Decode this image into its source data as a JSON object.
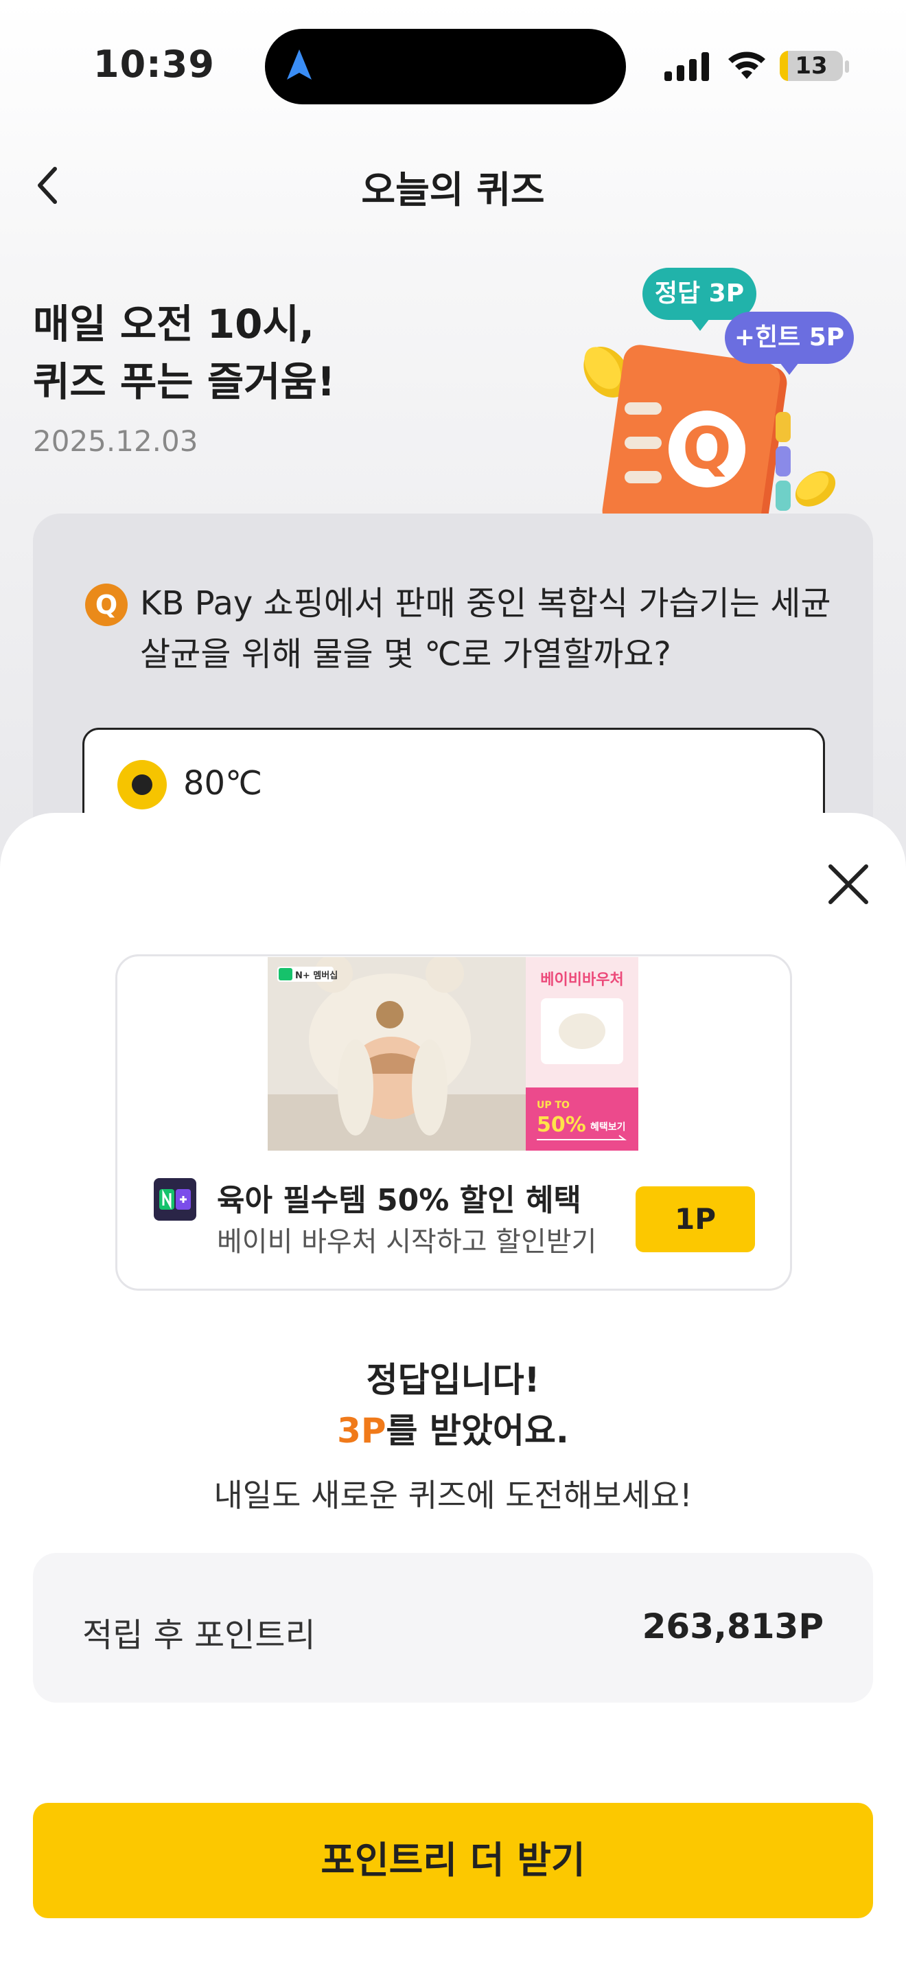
{
  "status_bar": {
    "time": "10:39",
    "battery": "13",
    "battery_level": 0.13
  },
  "header": {
    "title": "오늘의 퀴즈"
  },
  "hero": {
    "headline_line1": "매일 오전 10시,",
    "headline_line2": "퀴즈 푸는 즐거움!",
    "date": "2025.12.03",
    "badge_correct": "정답 3P",
    "badge_hint": "+힌트 5P",
    "illustration_letter": "Q"
  },
  "quiz": {
    "q_icon": "Q",
    "question_line1": "KB Pay 쇼핑에서 판매 중인 복합식 가습기는 세균",
    "question_line2": "살균을 위해 물을 몇 ℃로 가열할까요?",
    "selected_option": "80℃"
  },
  "ad": {
    "title": "육아 필수템 50% 할인 혜택",
    "subtitle": "베이비 바우처 시작하고 할인받기",
    "point_button": "1P",
    "image_brand": "N+ 멤버십",
    "image_heading": "베이비바우처",
    "image_upto": "UP TO",
    "image_percent": "50%",
    "image_suffix": "혜택보기"
  },
  "result": {
    "title": "정답입니다!",
    "points_accent": "3P",
    "points_suffix": "를 받았어요.",
    "desc": "내일도 새로운 퀴즈에 도전해보세요!"
  },
  "balance": {
    "label": "적립 후 포인트리",
    "value": "263,813P"
  },
  "cta": {
    "label": "포인트리 더 받기"
  },
  "colors": {
    "accent_yellow": "#fcc800",
    "badge_teal": "#21b3aa",
    "badge_purple": "#6b6ee0",
    "points_orange": "#f07a1a",
    "quiz_icon_orange": "#ea8a1a"
  },
  "icons": {
    "back": "chevron-left-icon",
    "close": "close-icon",
    "nav": "location-arrow-icon",
    "signal": "cellular-signal-icon",
    "wifi": "wifi-icon"
  }
}
